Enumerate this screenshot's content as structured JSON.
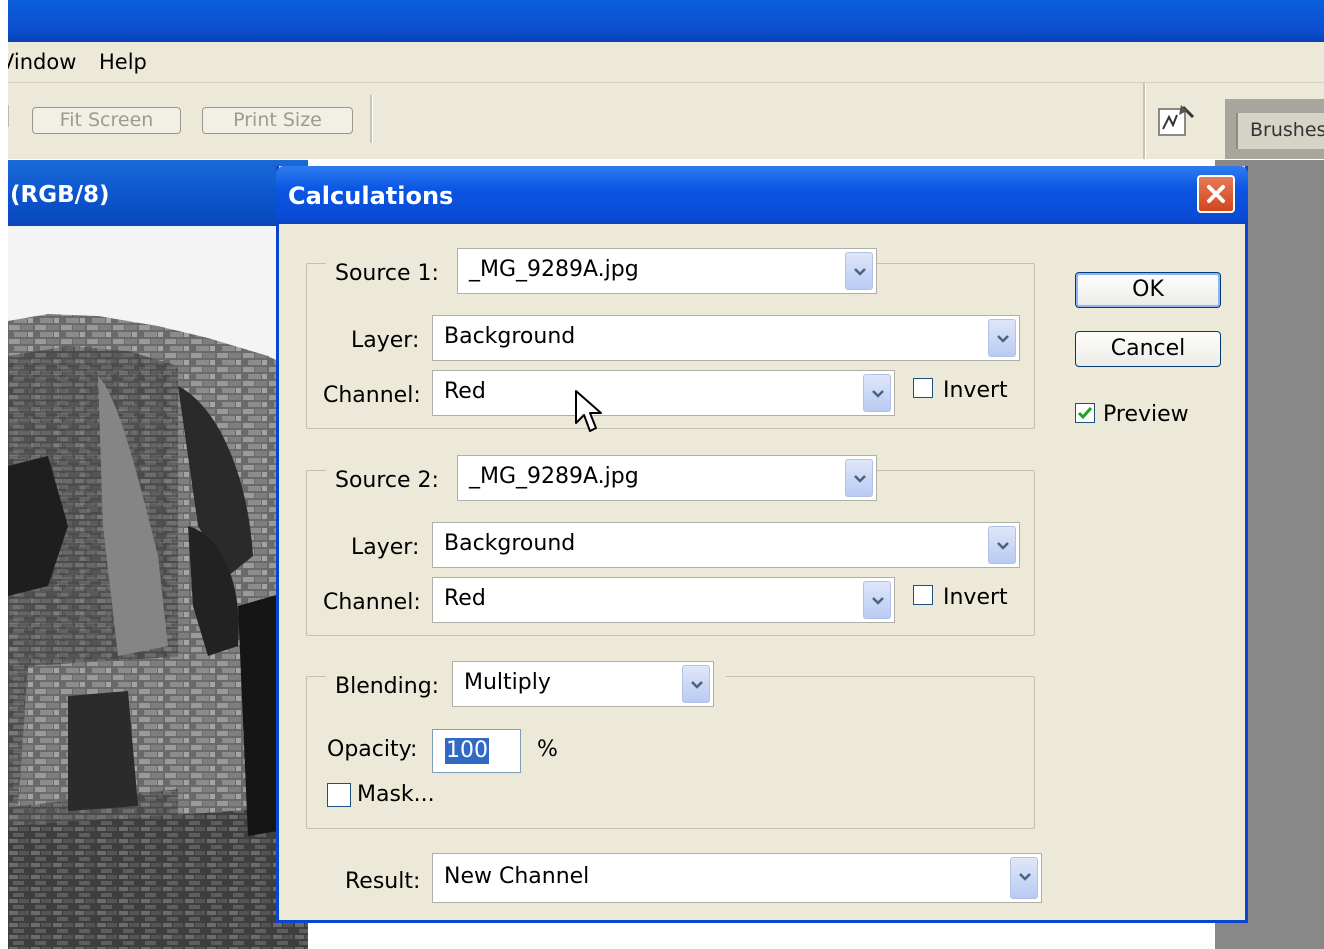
{
  "menu": {
    "items": [
      "Window",
      "Help"
    ],
    "window_label": "Vindow",
    "help_label": "Help"
  },
  "toolbar": {
    "fit_screen": "Fit Screen",
    "print_size": "Print Size",
    "brushes_tab": "Brushes"
  },
  "document": {
    "title": "(RGB/8)"
  },
  "dialog": {
    "title": "Calculations",
    "source1": {
      "label": "Source 1:",
      "file": "_MG_9289A.jpg",
      "layer_label": "Layer:",
      "layer": "Background",
      "channel_label": "Channel:",
      "channel": "Red",
      "invert_label": "Invert",
      "invert_checked": false
    },
    "source2": {
      "label": "Source 2:",
      "file": "_MG_9289A.jpg",
      "layer_label": "Layer:",
      "layer": "Background",
      "channel_label": "Channel:",
      "channel": "Red",
      "invert_label": "Invert",
      "invert_checked": false
    },
    "blending": {
      "label": "Blending:",
      "mode": "Multiply",
      "opacity_label": "Opacity:",
      "opacity": "100",
      "percent": "%",
      "mask_label": "Mask...",
      "mask_checked": false
    },
    "result": {
      "label": "Result:",
      "value": "New Channel"
    },
    "ok": "OK",
    "cancel": "Cancel",
    "preview_label": "Preview",
    "preview_checked": true
  }
}
